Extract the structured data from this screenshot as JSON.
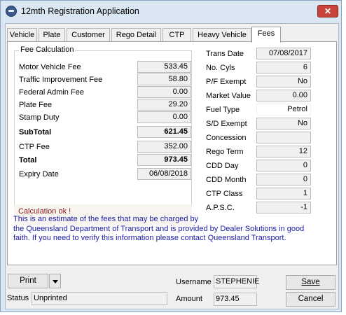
{
  "window": {
    "title": "12mth Registration Application",
    "close_icon": "close-icon"
  },
  "tabs": [
    "Vehicle",
    "Plate",
    "Customer",
    "Rego Detail",
    "CTP",
    "Heavy Vehicle",
    "Fees"
  ],
  "active_tab": "Fees",
  "fee_calculation": {
    "legend": "Fee Calculation",
    "rows": [
      {
        "label": "Motor Vehicle Fee",
        "value": "533.45"
      },
      {
        "label": "Traffic Improvement Fee",
        "value": "58.80"
      },
      {
        "label": "Federal Admin Fee",
        "value": "0.00"
      },
      {
        "label": "Plate Fee",
        "value": "29.20"
      },
      {
        "label": "Stamp Duty",
        "value": "0.00"
      },
      {
        "label": "SubTotal",
        "value": "621.45"
      },
      {
        "label": "CTP Fee",
        "value": "352.00"
      },
      {
        "label": "Total",
        "value": "973.45"
      },
      {
        "label": "Expiry Date",
        "value": "06/08/2018"
      }
    ],
    "status": "Calculation ok !"
  },
  "details": [
    {
      "label": "Trans Date",
      "value": "07/08/2017"
    },
    {
      "label": "No. Cyls",
      "value": "6"
    },
    {
      "label": "P/F Exempt",
      "value": "No"
    },
    {
      "label": "Market Value",
      "value": "0.00"
    },
    {
      "label": "Fuel Type",
      "value": "Petrol"
    },
    {
      "label": "S/D Exempt",
      "value": "No"
    },
    {
      "label": "Concession",
      "value": ""
    },
    {
      "label": "Rego Term",
      "value": "12"
    },
    {
      "label": "CDD Day",
      "value": "0"
    },
    {
      "label": "CDD Month",
      "value": "0"
    },
    {
      "label": "CTP Class",
      "value": "1"
    },
    {
      "label": "A.P.S.C.",
      "value": "-1"
    }
  ],
  "disclaimer": [
    "This is an estimate of the fees that may be charged by",
    "the Queensland Department of Transport and is provided by Dealer Solutions in good",
    "faith.  If you need to verify this information please contact Queensland Transport."
  ],
  "footer": {
    "print_label": "Print",
    "status_label": "Status",
    "status_value": "Unprinted",
    "username_label": "Username",
    "username_value": "STEPHENIE",
    "amount_label": "Amount",
    "amount_value": "973.45",
    "save_label": "Save",
    "cancel_label": "Cancel"
  },
  "colors": {
    "accent": "#1a1aa6",
    "status_text": "#8b1a1a",
    "close_button": "#c8443a"
  }
}
